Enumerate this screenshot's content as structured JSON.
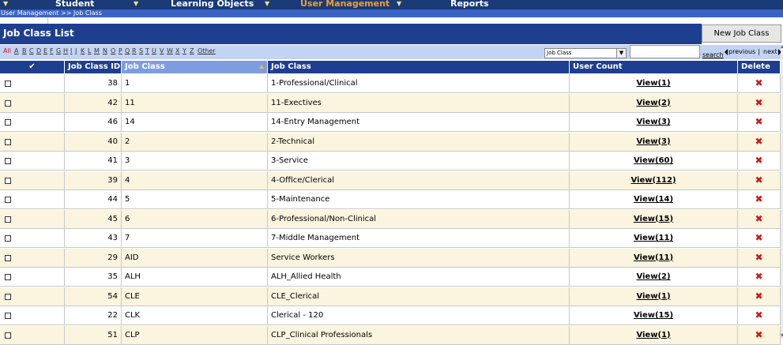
{
  "nav": {
    "items": [
      {
        "label": "Student"
      },
      {
        "label": "Learning Objects"
      },
      {
        "label": "User Management"
      },
      {
        "label": "Reports"
      }
    ]
  },
  "breadcrumb": "User Management >> Job Class",
  "page_title": "Job Class List",
  "new_button": "New Job Class",
  "alphabet": [
    "All",
    "A",
    "B",
    "C",
    "D",
    "E",
    "F",
    "G",
    "H",
    "I",
    "J",
    "K",
    "L",
    "M",
    "N",
    "O",
    "P",
    "Q",
    "R",
    "S",
    "T",
    "U",
    "V",
    "W",
    "X",
    "Y",
    "Z",
    "Other"
  ],
  "filter": {
    "selected": "Job Class",
    "search_value": "",
    "search_label": "search",
    "prev_label": "previous",
    "next_label": "next",
    "separator": "|"
  },
  "table": {
    "headers": {
      "check": "✔",
      "id": "Job Class ID",
      "code": "Job Class",
      "name": "Job Class",
      "count": "User Count",
      "delete": "Delete"
    },
    "rows": [
      {
        "id": "38",
        "code": "1",
        "name": "1-Professional/Clinical",
        "count": "View(1)"
      },
      {
        "id": "42",
        "code": "11",
        "name": "11-Exectives",
        "count": "View(2)"
      },
      {
        "id": "46",
        "code": "14",
        "name": "14-Entry Management",
        "count": "View(3)"
      },
      {
        "id": "40",
        "code": "2",
        "name": "2-Technical",
        "count": "View(3)"
      },
      {
        "id": "41",
        "code": "3",
        "name": "3-Service",
        "count": "View(60)"
      },
      {
        "id": "39",
        "code": "4",
        "name": "4-Office/Clerical",
        "count": "View(112)"
      },
      {
        "id": "44",
        "code": "5",
        "name": "5-Maintenance",
        "count": "View(14)"
      },
      {
        "id": "45",
        "code": "6",
        "name": "6-Professional/Non-Clinical",
        "count": "View(15)"
      },
      {
        "id": "43",
        "code": "7",
        "name": "7-Middle Management",
        "count": "View(11)"
      },
      {
        "id": "29",
        "code": "AID",
        "name": "Service Workers",
        "count": "View(11)"
      },
      {
        "id": "35",
        "code": "ALH",
        "name": "ALH_Allied Health",
        "count": "View(2)"
      },
      {
        "id": "54",
        "code": "CLE",
        "name": "CLE_Clerical",
        "count": "View(1)"
      },
      {
        "id": "22",
        "code": "CLK",
        "name": "Clerical - 120",
        "count": "View(15)"
      },
      {
        "id": "51",
        "code": "CLP",
        "name": "CLP_Clinical Professionals",
        "count": "View(1)"
      }
    ]
  },
  "colors": {
    "nav_bg": "#1a3a78",
    "title_bg": "#1e3e90",
    "alpha_bg": "#c3d3f3",
    "alt_row": "#fbf4df",
    "active_nav": "#f0a030",
    "delete_icon": "#d01a1a"
  }
}
